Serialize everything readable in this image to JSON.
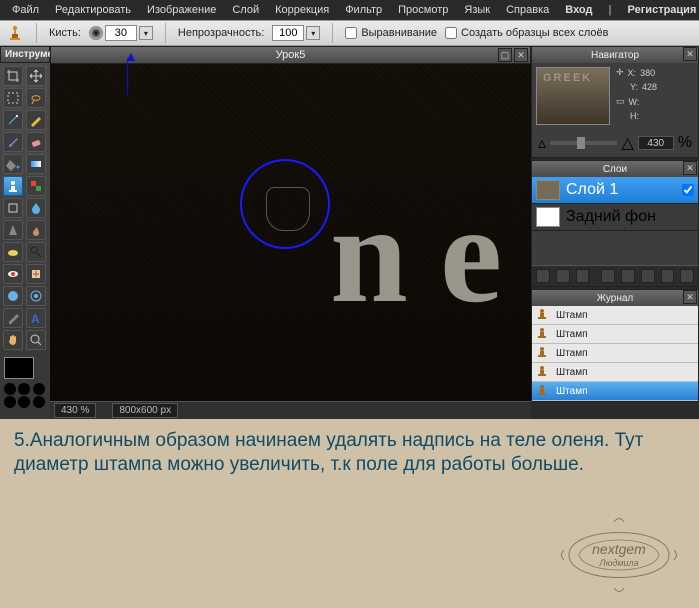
{
  "menu": {
    "items": [
      "Файл",
      "Редактировать",
      "Изображение",
      "Слой",
      "Коррекция",
      "Фильтр",
      "Просмотр",
      "Язык",
      "Справка"
    ],
    "right": [
      "Вход",
      "Регистрация"
    ]
  },
  "options": {
    "brush_label": "Кисть:",
    "brush_size": "30",
    "opacity_label": "Непрозрачность:",
    "opacity_value": "100",
    "align_label": "Выравнивание",
    "sample_label": "Создать образцы всех слоёв"
  },
  "toolbox": {
    "title": "Инструмен"
  },
  "canvas": {
    "title": "Урок5",
    "status_zoom": "430 %",
    "status_dim": "800x600 px"
  },
  "navigator": {
    "title": "Навигатор",
    "x_label": "X:",
    "x_val": "380",
    "y_label": "Y:",
    "y_val": "428",
    "w_label": "W:",
    "w_val": "",
    "h_label": "H:",
    "h_val": "",
    "zoom": "430",
    "pct": "%",
    "thumb_label": "GREEK"
  },
  "layers": {
    "title": "Слои",
    "items": [
      {
        "name": "Слой 1",
        "active": true,
        "thumb": "tex"
      },
      {
        "name": "Задний фон",
        "active": false,
        "thumb": "white"
      }
    ]
  },
  "history": {
    "title": "Журнал",
    "items": [
      "Штамп",
      "Штамп",
      "Штамп",
      "Штамп",
      "Штамп"
    ]
  },
  "tutorial": {
    "text": "5.Аналогичным образом начинаем удалять надпись на теле оленя. Тут диаметр штампа можно увеличить, т.к  поле для работы больше.",
    "wm1": "nextgem",
    "wm2": "Людмила"
  }
}
